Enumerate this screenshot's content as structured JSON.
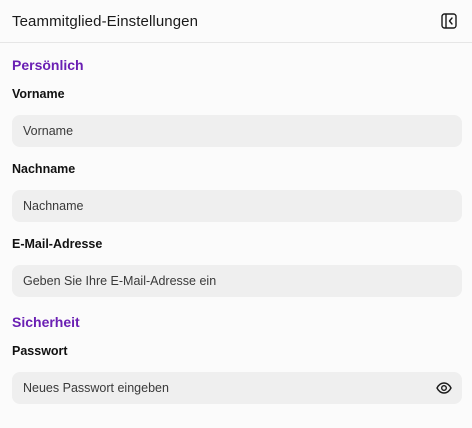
{
  "header": {
    "title": "Teammitglied-Einstellungen",
    "collapse_icon": "panel-collapse-icon"
  },
  "sections": {
    "personal": {
      "title": "Persönlich",
      "first_name": {
        "label": "Vorname",
        "placeholder": "Vorname",
        "value": ""
      },
      "last_name": {
        "label": "Nachname",
        "placeholder": "Nachname",
        "value": ""
      },
      "email": {
        "label": "E-Mail-Adresse",
        "placeholder": "Geben Sie Ihre E-Mail-Adresse ein",
        "value": ""
      }
    },
    "security": {
      "title": "Sicherheit",
      "password": {
        "label": "Passwort",
        "placeholder": "Neues Passwort eingeben",
        "value": "",
        "toggle_icon": "eye-icon"
      }
    }
  },
  "colors": {
    "accent": "#6a1fb3",
    "input_bg": "#efefef",
    "page_bg": "#fbfbfb",
    "divider": "#e6e6e6"
  }
}
